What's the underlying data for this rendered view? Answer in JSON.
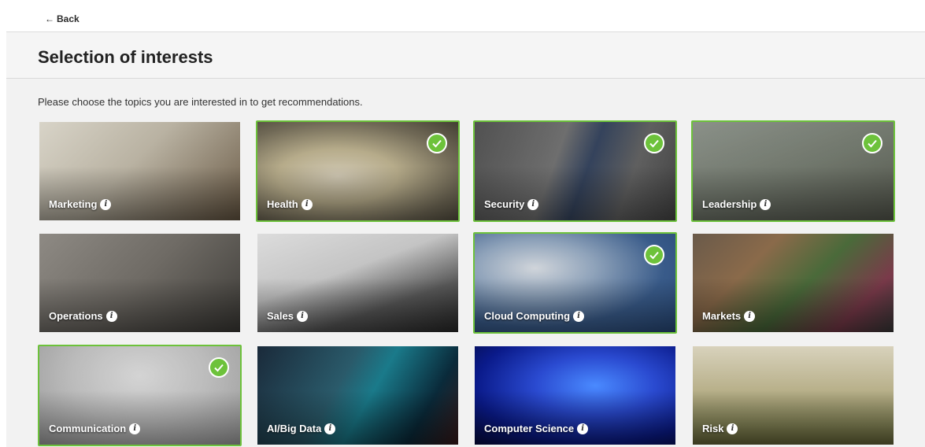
{
  "nav": {
    "back_label": "Back",
    "back_arrow": "←"
  },
  "page": {
    "title": "Selection of interests",
    "intro": "Please choose the topics you are interested in to get recommendations."
  },
  "colors": {
    "accent": "#6dc23b",
    "background": "#f2f2f2"
  },
  "topics": [
    {
      "label": "Marketing",
      "selected": false,
      "icon": "info-icon"
    },
    {
      "label": "Health",
      "selected": true,
      "icon": "info-icon"
    },
    {
      "label": "Security",
      "selected": true,
      "icon": "info-icon"
    },
    {
      "label": "Leadership",
      "selected": true,
      "icon": "info-icon"
    },
    {
      "label": "Operations",
      "selected": false,
      "icon": "info-icon"
    },
    {
      "label": "Sales",
      "selected": false,
      "icon": "info-icon"
    },
    {
      "label": "Cloud Computing",
      "selected": true,
      "icon": "info-icon"
    },
    {
      "label": "Markets",
      "selected": false,
      "icon": "info-icon"
    },
    {
      "label": "Communication",
      "selected": true,
      "icon": "info-icon"
    },
    {
      "label": "AI/Big Data",
      "selected": false,
      "icon": "info-icon"
    },
    {
      "label": "Computer Science",
      "selected": false,
      "icon": "info-icon"
    },
    {
      "label": "Risk",
      "selected": false,
      "icon": "info-icon"
    }
  ]
}
